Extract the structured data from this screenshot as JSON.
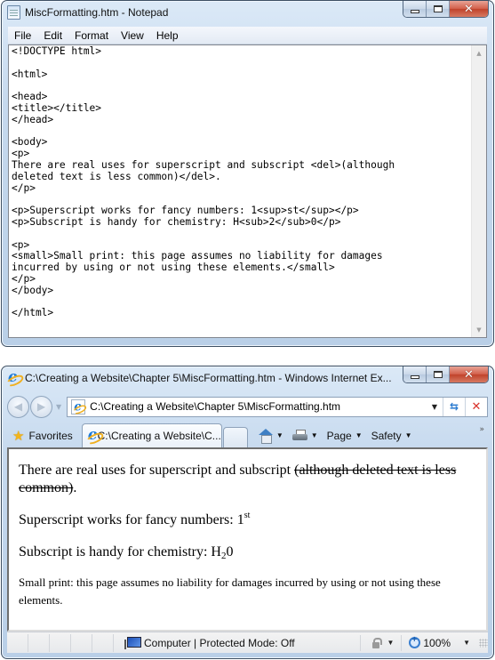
{
  "notepad": {
    "title": "MiscFormatting.htm - Notepad",
    "menu": [
      "File",
      "Edit",
      "Format",
      "View",
      "Help"
    ],
    "content": "<!DOCTYPE html>\n\n<html>\n\n<head>\n<title></title>\n</head>\n\n<body>\n<p>\nThere are real uses for superscript and subscript <del>(although\ndeleted text is less common)</del>.\n</p>\n\n<p>Superscript works for fancy numbers: 1<sup>st</sup></p>\n<p>Subscript is handy for chemistry: H<sub>2</sub>0</p>\n\n<p>\n<small>Small print: this page assumes no liability for damages\nincurred by using or not using these elements.</small>\n</p>\n</body>\n\n</html>"
  },
  "ie": {
    "title": "C:\\Creating a Website\\Chapter 5\\MiscFormatting.htm - Windows Internet Ex...",
    "address": "C:\\Creating a Website\\Chapter 5\\MiscFormatting.htm",
    "favorites_label": "Favorites",
    "tab_label": "C:\\Creating a Website\\C...",
    "commands": {
      "page": "Page",
      "safety": "Safety"
    },
    "page": {
      "p1_text": "There are real uses for superscript and subscript ",
      "p1_deleted": "(although deleted text is less common)",
      "p1_end": ".",
      "p2_text": "Superscript works for fancy numbers: 1",
      "p2_sup": "st",
      "p3_text": "Subscript is handy for chemistry: H",
      "p3_sub": "2",
      "p3_end": "0",
      "p4_small": "Small print: this page assumes no liability for damages incurred by using or not using these elements."
    },
    "status": {
      "zone": "Computer | Protected Mode: Off",
      "zoom": "100%"
    }
  },
  "icons": {
    "minimize": "minimize-icon",
    "maximize": "maximize-icon",
    "close": "close-icon",
    "back": "back-arrow-icon",
    "forward": "forward-arrow-icon",
    "refresh": "refresh-icon",
    "stop": "stop-icon",
    "home": "home-icon",
    "print": "printer-icon",
    "favorites": "star-icon",
    "zoom": "magnifier-icon",
    "zone": "computer-icon",
    "protected": "lock-icon"
  },
  "glyphs": {
    "close": "✕",
    "back": "◀",
    "forward": "▶",
    "dropdown": "▼",
    "refresh": "⇆",
    "stop": "✕",
    "star": "★",
    "chevron": "»",
    "scroll_up": "▲",
    "scroll_down": "▼"
  }
}
